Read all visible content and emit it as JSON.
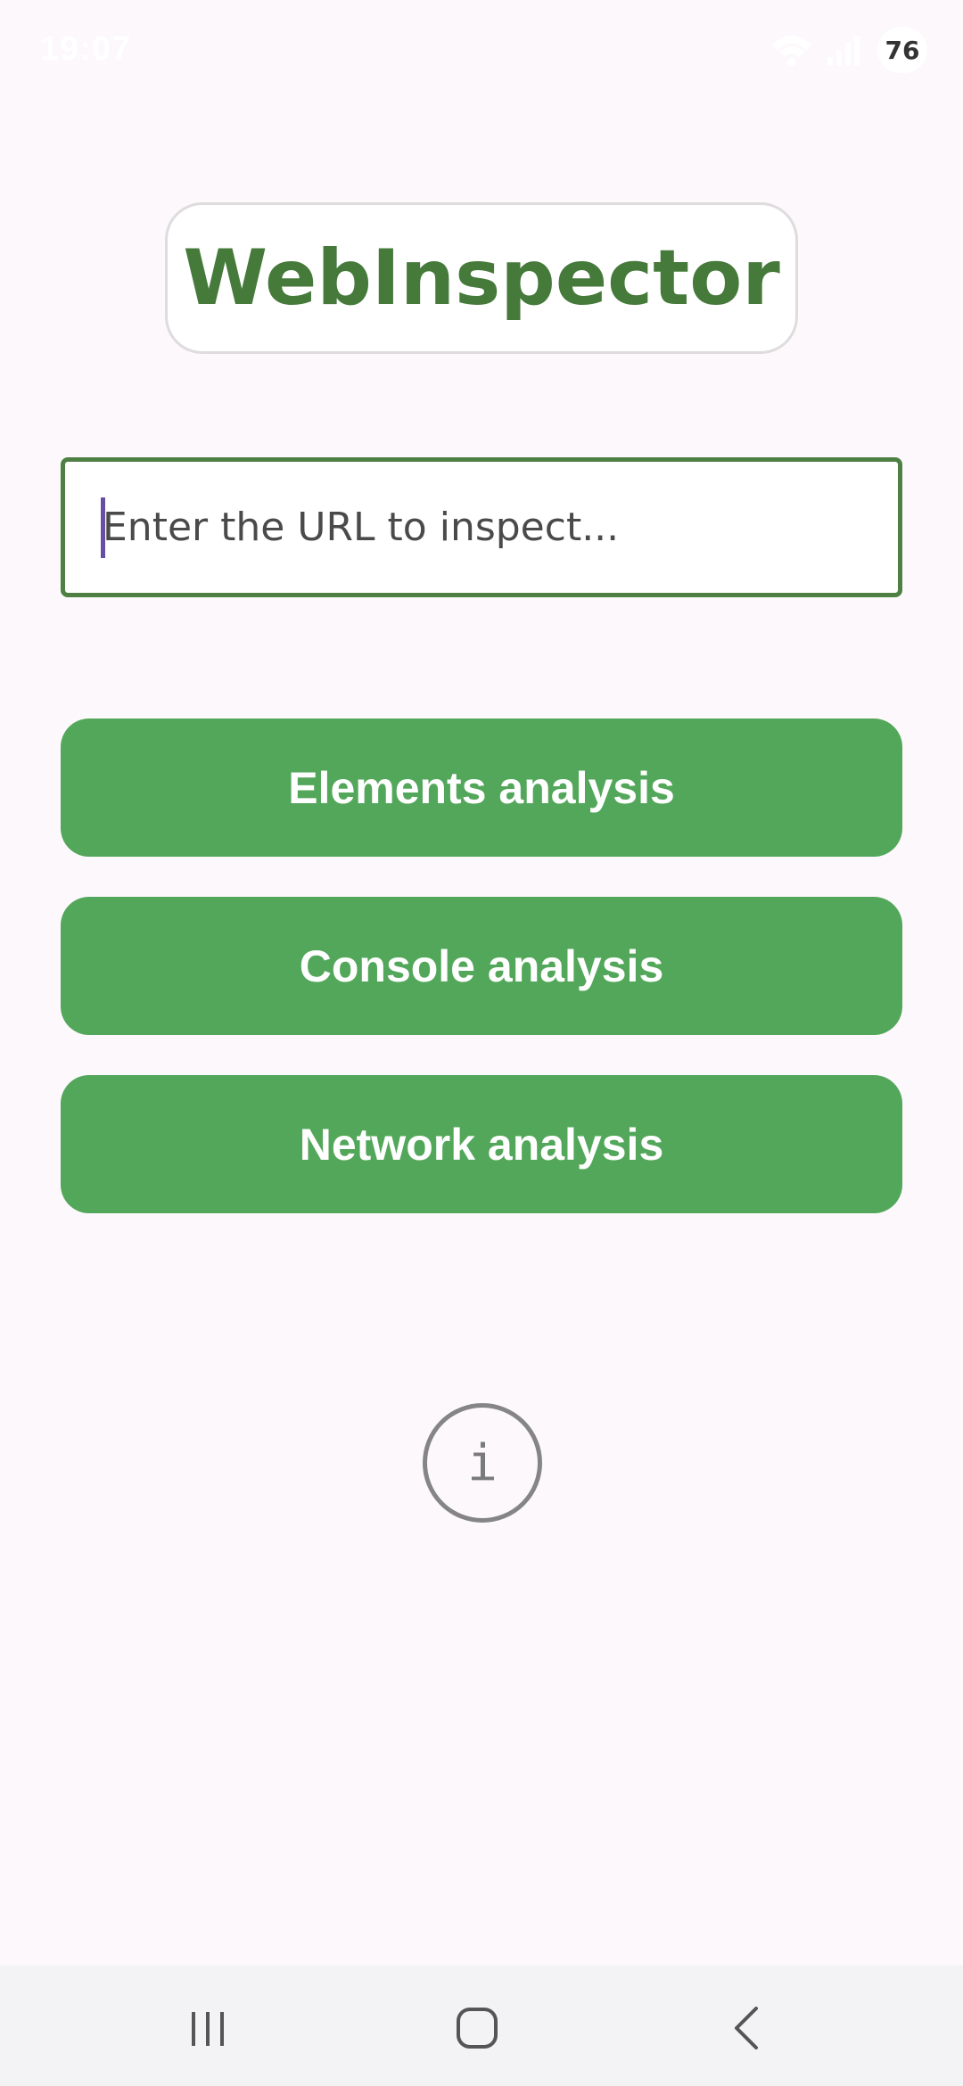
{
  "status_bar": {
    "time": "19:07",
    "battery": "76"
  },
  "app": {
    "title": "WebInspector"
  },
  "url_field": {
    "value": "",
    "placeholder": "Enter the URL to inspect..."
  },
  "buttons": {
    "elements": "Elements analysis",
    "console": "Console analysis",
    "network": "Network analysis"
  },
  "info": {
    "glyph": "i",
    "icon": "info-icon"
  },
  "nav": {
    "recents_icon": "recents-icon",
    "home_icon": "home-icon",
    "back_icon": "back-icon"
  },
  "colors": {
    "title_green": "#457a3a",
    "button_green": "#53a75a",
    "field_border": "#4e7f43",
    "caret": "#6750a4",
    "background": "#fcf8fc"
  }
}
